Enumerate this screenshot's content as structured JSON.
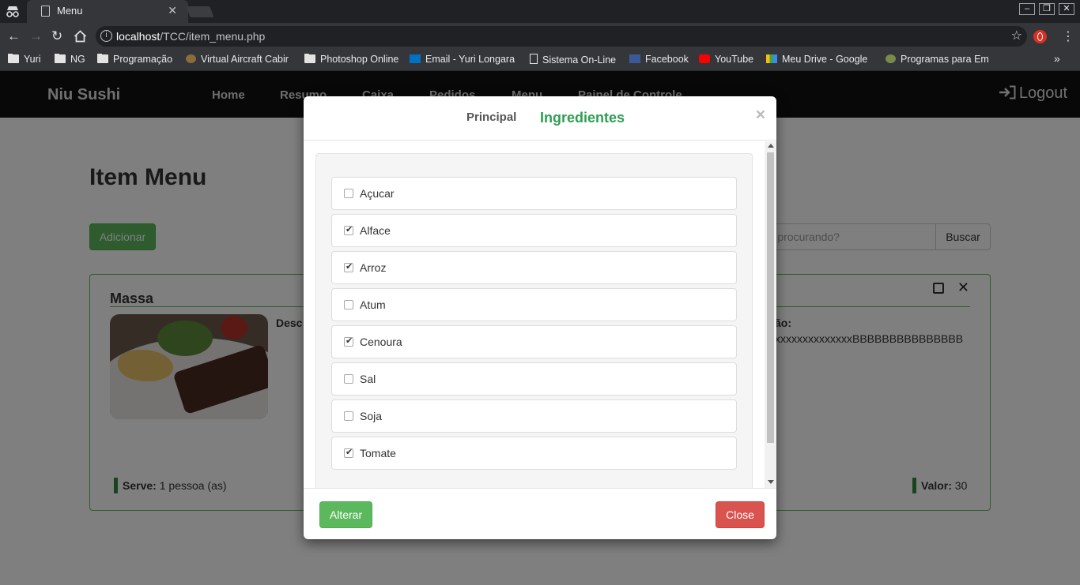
{
  "browser": {
    "tab_title": "Menu",
    "url_host": "localhost",
    "url_path": "/TCC/item_menu.php",
    "bookmarks": [
      {
        "label": "Yuri",
        "icon": "folder-icon"
      },
      {
        "label": "NG",
        "icon": "folder-icon"
      },
      {
        "label": "Programação",
        "icon": "folder-icon"
      },
      {
        "label": "Virtual Aircraft Cabir",
        "icon": "site-icon"
      },
      {
        "label": "Photoshop Online",
        "icon": "folder-icon"
      },
      {
        "label": "Email - Yuri Longara",
        "icon": "outlook-icon"
      },
      {
        "label": "Sistema On-Line",
        "icon": "page-icon"
      },
      {
        "label": "Facebook",
        "icon": "facebook-icon"
      },
      {
        "label": "YouTube",
        "icon": "youtube-icon"
      },
      {
        "label": "Meu Drive - Google",
        "icon": "drive-icon"
      },
      {
        "label": "Programas para Em",
        "icon": "site-icon"
      }
    ],
    "more_bookmarks": "»"
  },
  "navbar": {
    "brand": "Niu Sushi",
    "links": [
      "Home",
      "Resumo",
      "Caixa",
      "Pedidos",
      "Menu",
      "Painel de Controle"
    ],
    "logout": "Logout"
  },
  "main": {
    "title": "Item Menu",
    "add_button": "Adicionar",
    "search_placeholder": "está procurando?",
    "search_button": "Buscar"
  },
  "card": {
    "title": "Massa",
    "desc_label_left": "Desc",
    "desc_label_right": "ão:",
    "desc_text": "xxxxxxxxxxxxxxBBBBBBBBBBBBBBB",
    "serves_label": "Serve:",
    "serves_value": " 1 pessoa (as)",
    "value_label": "Valor:",
    "value_value": " 30"
  },
  "modal": {
    "tab_principal": "Principal",
    "tab_ingredientes": "Ingredientes",
    "close_x": "×",
    "ingredients": [
      {
        "label": "Açucar",
        "checked": false
      },
      {
        "label": "Alface",
        "checked": true
      },
      {
        "label": "Arroz",
        "checked": true
      },
      {
        "label": "Atum",
        "checked": false
      },
      {
        "label": "Cenoura",
        "checked": true
      },
      {
        "label": "Sal",
        "checked": false
      },
      {
        "label": "Soja",
        "checked": false
      },
      {
        "label": "Tomate",
        "checked": true
      }
    ],
    "alterar_button": "Alterar",
    "close_button": "Close"
  },
  "colors": {
    "accent_green": "#5cb85c",
    "tab_active_green": "#2e9e52",
    "danger_red": "#d9534f",
    "navbar_bg": "#111111"
  }
}
